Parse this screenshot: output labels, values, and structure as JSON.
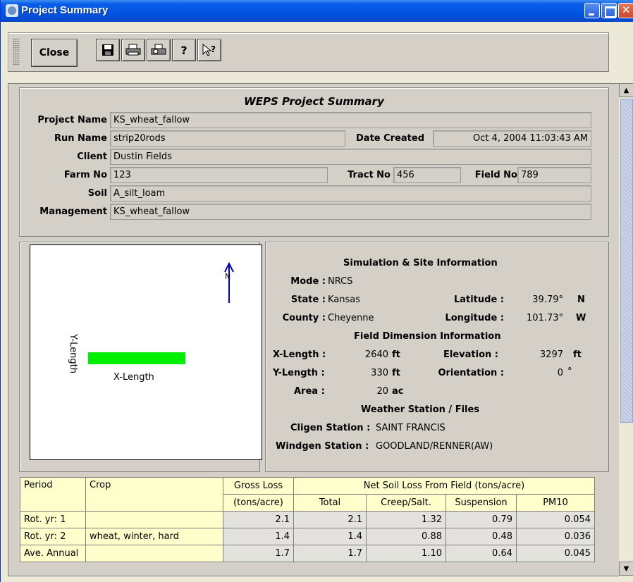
{
  "window": {
    "title": "Project Summary"
  },
  "toolbar": {
    "close_label": "Close",
    "icons": [
      "save-icon",
      "print-icon",
      "print-preview-icon",
      "help-icon",
      "context-help-icon"
    ]
  },
  "summary": {
    "heading": "WEPS Project Summary",
    "project_name": {
      "label": "Project Name",
      "value": "KS_wheat_fallow"
    },
    "run_name": {
      "label": "Run Name",
      "value": "strip20rods"
    },
    "date_created": {
      "label": "Date Created",
      "value": "Oct 4, 2004 11:03:43 AM"
    },
    "client": {
      "label": "Client",
      "value": "Dustin Fields"
    },
    "farm_no": {
      "label": "Farm No",
      "value": "123"
    },
    "tract_no": {
      "label": "Tract No",
      "value": "456"
    },
    "field_no": {
      "label": "Field No",
      "value": "789"
    },
    "soil": {
      "label": "Soil",
      "value": "A_silt_loam"
    },
    "management": {
      "label": "Management",
      "value": "KS_wheat_fallow"
    }
  },
  "map": {
    "north_label": "N",
    "x_label": "X-Length",
    "y_label": "Y-Length",
    "field_color": "#00ee00",
    "arrow_color": "#0000cc"
  },
  "site": {
    "heading": "Simulation & Site Information",
    "mode_label": "Mode :",
    "mode": "NRCS",
    "state_label": "State :",
    "state": "Kansas",
    "county_label": "County :",
    "county": "Cheyenne",
    "latitude_label": "Latitude :",
    "latitude": "39.79°",
    "lat_dir": "N",
    "longitude_label": "Longitude :",
    "longitude": "101.73°",
    "lon_dir": "W",
    "dim_heading": "Field Dimension Information",
    "xlen_label": "X-Length :",
    "xlen": "2640",
    "xlen_unit": "ft",
    "ylen_label": "Y-Length :",
    "ylen": "330",
    "ylen_unit": "ft",
    "area_label": "Area :",
    "area": "20",
    "area_unit": "ac",
    "elev_label": "Elevation :",
    "elev": "3297",
    "elev_unit": "ft",
    "orient_label": "Orientation :",
    "orient": "0",
    "orient_unit": "°",
    "weather_heading": "Weather Station / Files",
    "cligen_label": "Cligen Station :",
    "cligen": "SAINT FRANCIS",
    "windgen_label": "Windgen Station :",
    "windgen": "GOODLAND/RENNER(AW)"
  },
  "results": {
    "h_period": "Period",
    "h_crop": "Crop",
    "h_gross": "Gross Loss",
    "h_gross_unit": "(tons/acre)",
    "h_net": "Net Soil Loss From Field (tons/acre)",
    "h_total": "Total",
    "h_creep": "Creep/Salt.",
    "h_susp": "Suspension",
    "h_pm10": "PM10",
    "rows": [
      {
        "period": "Rot. yr:  1",
        "crop": "",
        "gross": "2.1",
        "total": "2.1",
        "creep": "1.32",
        "susp": "0.79",
        "pm10": "0.054"
      },
      {
        "period": "Rot. yr:  2",
        "crop": "wheat, winter, hard",
        "gross": "1.4",
        "total": "1.4",
        "creep": "0.88",
        "susp": "0.48",
        "pm10": "0.036"
      },
      {
        "period": "Ave. Annual",
        "crop": "",
        "gross": "1.7",
        "total": "1.7",
        "creep": "1.10",
        "susp": "0.64",
        "pm10": "0.045"
      }
    ]
  }
}
